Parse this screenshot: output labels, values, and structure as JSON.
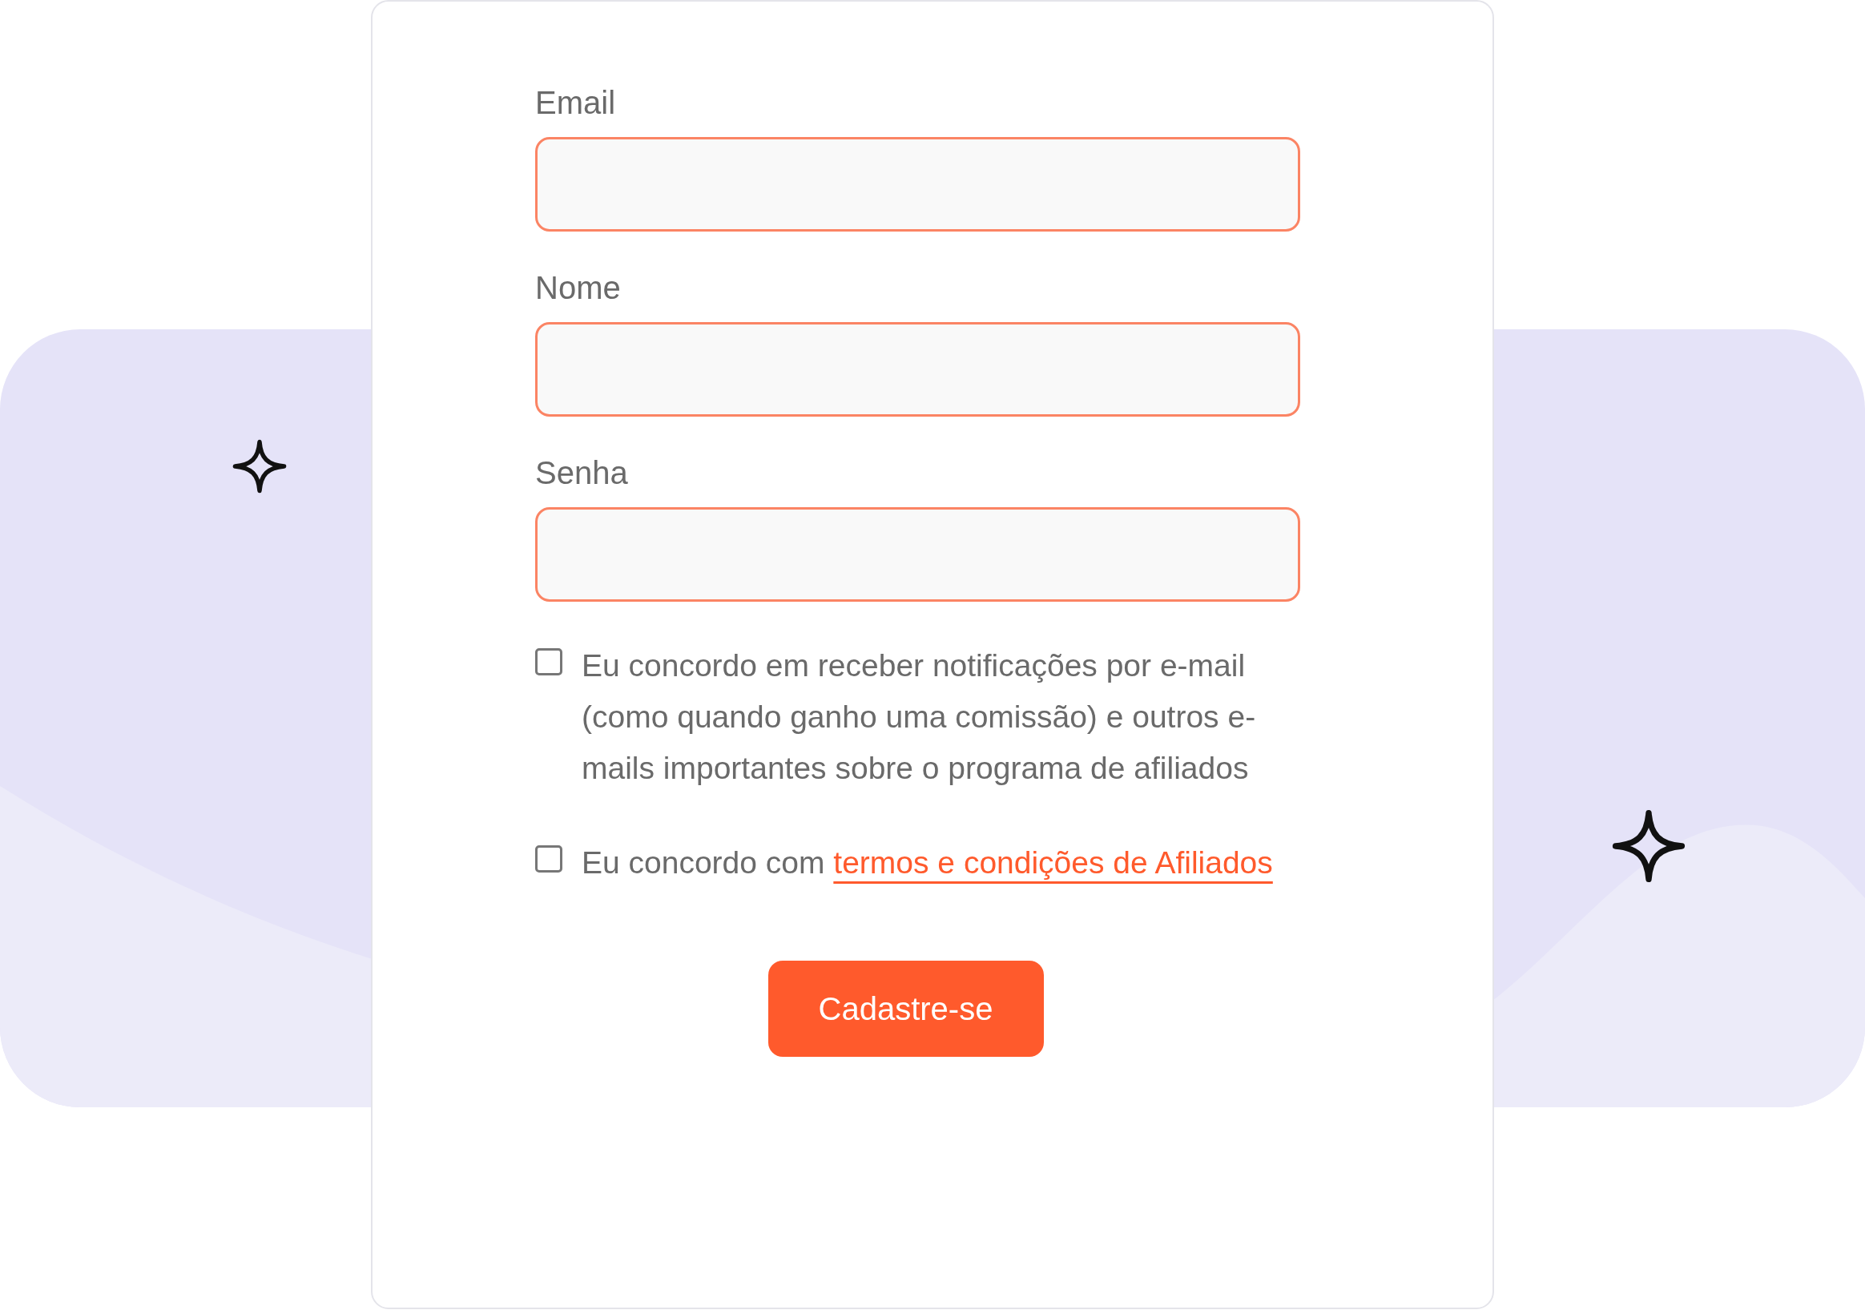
{
  "fields": [
    {
      "label": "Email"
    },
    {
      "label": "Nome"
    },
    {
      "label": "Senha"
    }
  ],
  "checkboxes": [
    {
      "kind": "plain",
      "checked": false,
      "text": "Eu concordo em receber notificações por e-mail (como quando ganho uma comissão) e outros e-mails importantes sobre o programa de afiliados"
    },
    {
      "kind": "link",
      "checked": false,
      "text": "Eu concordo com",
      "link": "termos e condições de Afiliados"
    }
  ],
  "submit": "Cadastre-se"
}
